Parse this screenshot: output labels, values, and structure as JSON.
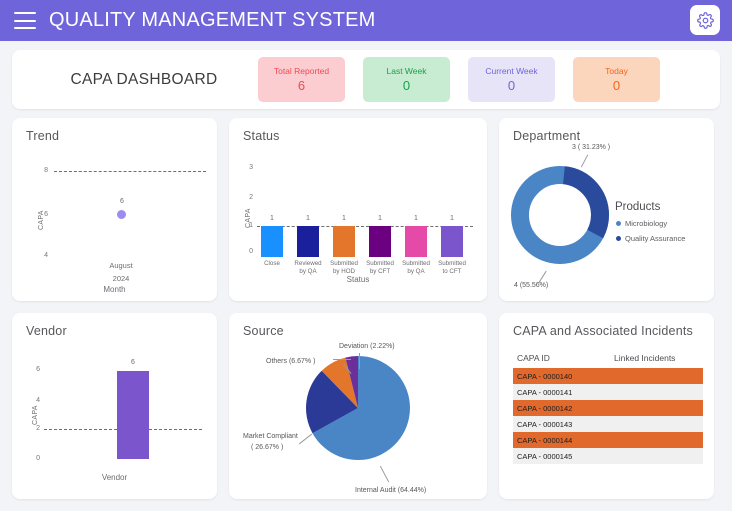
{
  "header": {
    "title": "QUALITY MANAGEMENT SYSTEM",
    "menu_icon": "hamburger-icon",
    "settings_icon": "gear-icon",
    "bar_color": "#6f64d9"
  },
  "summary": {
    "dashboard_title": "CAPA DASHBOARD",
    "kpis": [
      {
        "label": "Total Reported",
        "value": "6",
        "bg": "#fbcdd0",
        "fg": "#f04a55"
      },
      {
        "label": "Last Week",
        "value": "0",
        "bg": "#c8ecd1",
        "fg": "#19a04a"
      },
      {
        "label": "Current Week",
        "value": "0",
        "bg": "#e7e4f7",
        "fg": "#6f64d9"
      },
      {
        "label": "Today",
        "value": "0",
        "bg": "#fbd6bd",
        "fg": "#f2661c"
      }
    ]
  },
  "panels": {
    "trend": {
      "title": "Trend"
    },
    "status": {
      "title": "Status"
    },
    "department": {
      "title": "Department",
      "legend_title": "Products"
    },
    "vendor": {
      "title": "Vendor"
    },
    "source": {
      "title": "Source"
    },
    "incidents": {
      "title": "CAPA and Associated Incidents",
      "columns": [
        "CAPA ID",
        "Linked Incidents"
      ],
      "rows": [
        {
          "capa_id": "CAPA - 0000140",
          "linked": "",
          "highlight": true
        },
        {
          "capa_id": "CAPA - 0000141",
          "linked": "",
          "highlight": false
        },
        {
          "capa_id": "CAPA - 0000142",
          "linked": "",
          "highlight": true
        },
        {
          "capa_id": "CAPA - 0000143",
          "linked": "",
          "highlight": false
        },
        {
          "capa_id": "CAPA - 0000144",
          "linked": "",
          "highlight": true
        },
        {
          "capa_id": "CAPA - 0000145",
          "linked": "",
          "highlight": false
        }
      ]
    }
  },
  "chart_data": [
    {
      "type": "scatter",
      "title": "Trend",
      "xlabel": "Month",
      "ylabel": "CAPA",
      "categories": [
        "August 2024"
      ],
      "x_tick_lines": [
        "August",
        "2024"
      ],
      "values": [
        6
      ],
      "point_labels": [
        "6"
      ],
      "yticks": [
        4,
        6,
        8
      ],
      "ylim": [
        3,
        9
      ],
      "grid": "dashed-at-8",
      "point_color": "#9b8cf0"
    },
    {
      "type": "bar",
      "title": "Status",
      "xlabel": "Status",
      "ylabel": "CAPA",
      "categories": [
        "Close",
        "Reviewed by QA",
        "Submitted by HOD",
        "Submitted by CFT",
        "Submitted by QA",
        "Submitted to CFT"
      ],
      "category_lines": [
        [
          "Close",
          ""
        ],
        [
          "Reviewed",
          "by QA"
        ],
        [
          "Submitted",
          "by HOD"
        ],
        [
          "Submitted",
          "by CFT"
        ],
        [
          "Submitted",
          "by QA"
        ],
        [
          "Submitted",
          "to CFT"
        ]
      ],
      "values": [
        1,
        1,
        1,
        1,
        1,
        1
      ],
      "bar_labels": [
        "1",
        "1",
        "1",
        "1",
        "1",
        "1"
      ],
      "colors": [
        "#1890ff",
        "#1a209c",
        "#e3762b",
        "#6b0080",
        "#e64aa8",
        "#7b55cc"
      ],
      "yticks": [
        0,
        1,
        2,
        3
      ],
      "ylim": [
        0,
        3
      ],
      "grid": "dashed-at-1"
    },
    {
      "type": "pie",
      "variant": "donut",
      "title": "Department",
      "legend_title": "Products",
      "labels": [
        "Microbiology",
        "Quality Assurance"
      ],
      "values": [
        4,
        3
      ],
      "percentages": [
        "55.56%",
        "31.23%"
      ],
      "data_labels": [
        "4 (55.56%)",
        "3 ( 31.23% )"
      ],
      "colors": [
        "#4a86c5",
        "#2a4a9c"
      ],
      "legend_position": "right"
    },
    {
      "type": "bar",
      "title": "Vendor",
      "xlabel": "Vendor",
      "ylabel": "CAPA",
      "categories": [
        "Vendor"
      ],
      "values": [
        6
      ],
      "bar_labels": [
        "6"
      ],
      "colors": [
        "#7b55cc"
      ],
      "yticks": [
        0,
        2,
        4,
        6
      ],
      "ylim": [
        0,
        6
      ],
      "grid": "dashed-at-2"
    },
    {
      "type": "pie",
      "title": "Source",
      "labels": [
        "Internal Audit",
        "Market Compliant",
        "Others",
        "Deviation"
      ],
      "percentages": [
        64.44,
        26.67,
        6.67,
        2.22
      ],
      "data_labels": [
        "Internal Audit (64.44%)",
        "Market Compliant ( 26.67% )",
        "Others (6.67% )",
        "Deviation (2.22%)"
      ],
      "label_lines": [
        [
          "Internal Audit (64.44%)"
        ],
        [
          "Market Compliant",
          "( 26.67% )"
        ],
        [
          "Others (6.67% )"
        ],
        [
          "Deviation (2.22%)"
        ]
      ],
      "colors": [
        "#4a86c5",
        "#2a3a96",
        "#e3762b",
        "#6b2f99"
      ]
    }
  ]
}
